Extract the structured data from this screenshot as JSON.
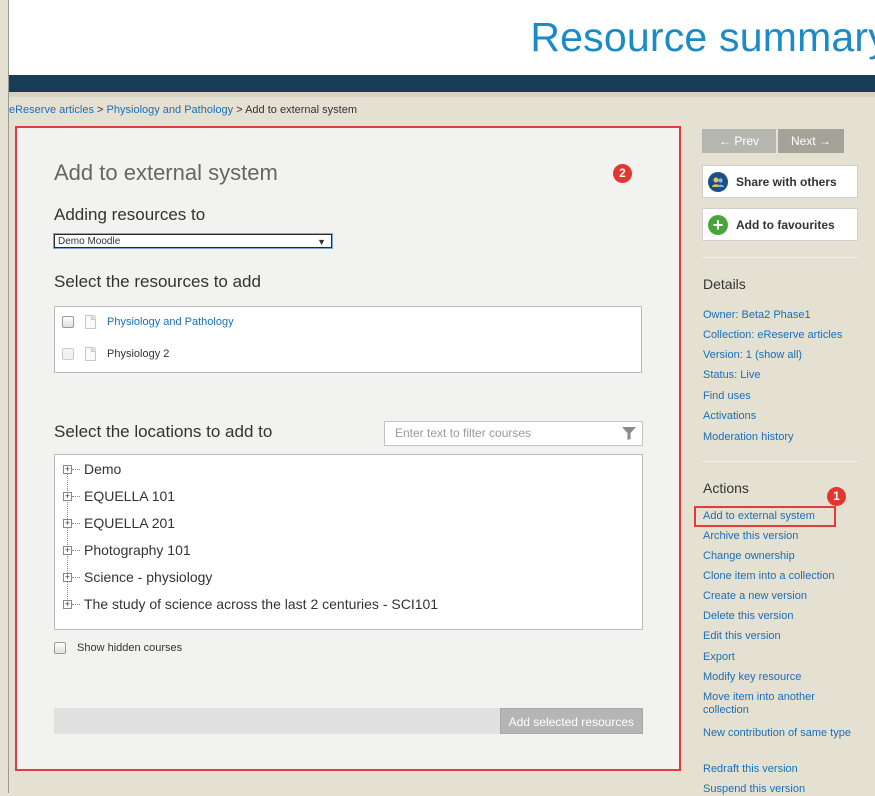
{
  "header": {
    "title": "Resource summary"
  },
  "breadcrumb": {
    "items": [
      "eReserve articles",
      "Physiology and Pathology",
      "Add to external system"
    ],
    "separator": ">"
  },
  "panel": {
    "title": "Add to external system",
    "badge": "2",
    "adding_label": "Adding resources to",
    "adding_value": "Demo Moodle",
    "resources_label": "Select the resources to add",
    "resources": [
      {
        "label": "Physiology and Pathology",
        "enabled": true
      },
      {
        "label": "Physiology 2",
        "enabled": false
      }
    ],
    "locations_label": "Select the locations to add to",
    "filter_placeholder": "Enter text to filter courses",
    "courses": [
      "Demo",
      "EQUELLA 101",
      "EQUELLA 201",
      "Photography 101",
      "Science - physiology",
      "The study of science across the last 2 centuries - SCI101"
    ],
    "show_hidden_label": "Show hidden courses",
    "add_button": "Add selected resources"
  },
  "sidebar": {
    "prev": "← Prev",
    "next": "Next →",
    "share": "Share with others",
    "favourites": "Add to favourites",
    "details_heading": "Details",
    "owner": "Owner: Beta2 Phase1",
    "collection_prefix": "Collection: ",
    "collection_value": "eReserve articles",
    "version_prefix": "Version: 1 (",
    "version_link": "show all",
    "version_suffix": ")",
    "status": "Status: Live",
    "find_uses": "Find uses",
    "activations": "Activations",
    "moderation": "Moderation history",
    "actions_heading": "Actions",
    "actions_badge": "1",
    "actions": [
      "Add to external system",
      "Archive this version",
      "Change ownership",
      "Clone item into a collection",
      "Create a new version",
      "Delete this version",
      "Edit this version",
      "Export",
      "Modify key resource",
      "Move item into another collection",
      "New contribution of same type",
      "Redraft this version",
      "Suspend this version"
    ]
  },
  "colors": {
    "title_blue": "#1b8bc6",
    "header_bar": "#173d57",
    "link_blue": "#1b6fb8",
    "highlight_red": "#e03c3c",
    "sidebar_bg": "#e4e0d2"
  }
}
